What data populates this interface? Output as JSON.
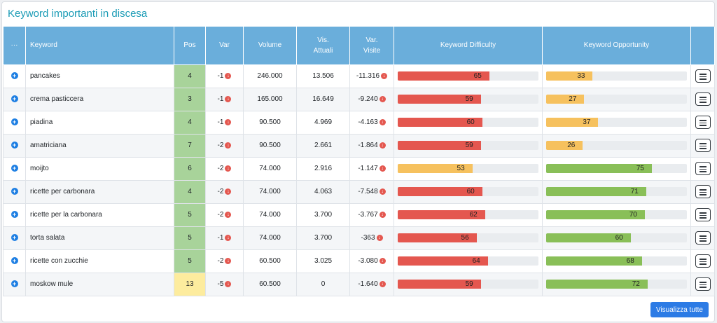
{
  "panel": {
    "title": "Keyword importanti in discesa",
    "view_all_label": "Visualizza tutte"
  },
  "columns": {
    "menu": "···",
    "keyword": "Keyword",
    "pos": "Pos",
    "var": "Var",
    "volume": "Volume",
    "vis_attuali": [
      "Vis.",
      "Attuali"
    ],
    "var_visite": [
      "Var.",
      "Visite"
    ],
    "kd": "Keyword Difficulty",
    "ko": "Keyword Opportunity"
  },
  "colors": {
    "red": "#e4574f",
    "orange": "#f6c15e",
    "green": "#89bf58",
    "pos_green": "#a8d39a",
    "pos_yellow": "#fdec9e"
  },
  "rows": [
    {
      "keyword": "pancakes",
      "pos": "4",
      "pos_color": "green",
      "var": "-1",
      "volume": "246.000",
      "vis": "13.506",
      "var_visite": "-11.316",
      "kd": 65,
      "kd_color": "red",
      "ko": 33,
      "ko_color": "orange"
    },
    {
      "keyword": "crema pasticcera",
      "pos": "3",
      "pos_color": "green",
      "var": "-1",
      "volume": "165.000",
      "vis": "16.649",
      "var_visite": "-9.240",
      "kd": 59,
      "kd_color": "red",
      "ko": 27,
      "ko_color": "orange"
    },
    {
      "keyword": "piadina",
      "pos": "4",
      "pos_color": "green",
      "var": "-1",
      "volume": "90.500",
      "vis": "4.969",
      "var_visite": "-4.163",
      "kd": 60,
      "kd_color": "red",
      "ko": 37,
      "ko_color": "orange"
    },
    {
      "keyword": "amatriciana",
      "pos": "7",
      "pos_color": "green",
      "var": "-2",
      "volume": "90.500",
      "vis": "2.661",
      "var_visite": "-1.864",
      "kd": 59,
      "kd_color": "red",
      "ko": 26,
      "ko_color": "orange"
    },
    {
      "keyword": "moijto",
      "pos": "6",
      "pos_color": "green",
      "var": "-2",
      "volume": "74.000",
      "vis": "2.916",
      "var_visite": "-1.147",
      "kd": 53,
      "kd_color": "orange",
      "ko": 75,
      "ko_color": "green"
    },
    {
      "keyword": "ricette per carbonara",
      "pos": "4",
      "pos_color": "green",
      "var": "-2",
      "volume": "74.000",
      "vis": "4.063",
      "var_visite": "-7.548",
      "kd": 60,
      "kd_color": "red",
      "ko": 71,
      "ko_color": "green"
    },
    {
      "keyword": "ricette per la carbonara",
      "pos": "5",
      "pos_color": "green",
      "var": "-2",
      "volume": "74.000",
      "vis": "3.700",
      "var_visite": "-3.767",
      "kd": 62,
      "kd_color": "red",
      "ko": 70,
      "ko_color": "green"
    },
    {
      "keyword": "torta salata",
      "pos": "5",
      "pos_color": "green",
      "var": "-1",
      "volume": "74.000",
      "vis": "3.700",
      "var_visite": "-363",
      "kd": 56,
      "kd_color": "red",
      "ko": 60,
      "ko_color": "green"
    },
    {
      "keyword": "ricette con zucchie",
      "pos": "5",
      "pos_color": "green",
      "var": "-2",
      "volume": "60.500",
      "vis": "3.025",
      "var_visite": "-3.080",
      "kd": 64,
      "kd_color": "red",
      "ko": 68,
      "ko_color": "green"
    },
    {
      "keyword": "moskow mule",
      "pos": "13",
      "pos_color": "yellow",
      "var": "-5",
      "volume": "60.500",
      "vis": "0",
      "var_visite": "-1.640",
      "kd": 59,
      "kd_color": "red",
      "ko": 72,
      "ko_color": "green"
    }
  ]
}
